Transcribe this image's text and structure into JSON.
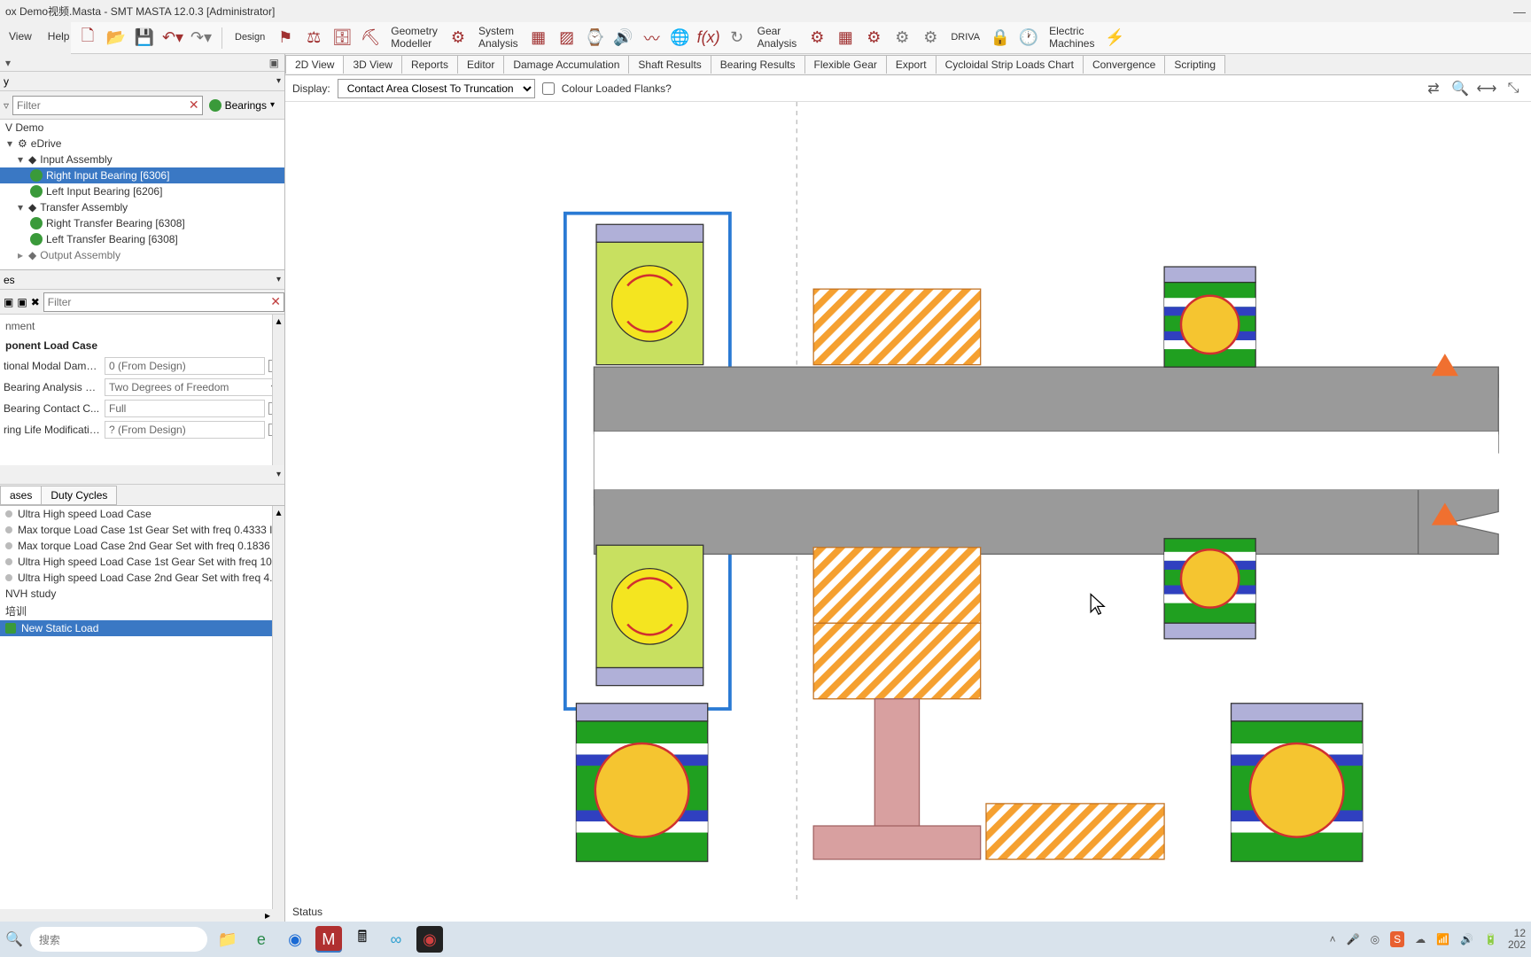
{
  "window": {
    "title": "ox Demo视频.Masta - SMT MASTA 12.0.3 [Administrator]"
  },
  "menu": {
    "view": "View",
    "help": "Help"
  },
  "toolbar": {
    "design": "Design",
    "geometry1": "Geometry",
    "geometry2": "Modeller",
    "system1": "System",
    "system2": "Analysis",
    "gear1": "Gear",
    "gear2": "Analysis",
    "driva": "DRIVA",
    "electric1": "Electric",
    "electric2": "Machines"
  },
  "subtabs": [
    "2D View",
    "3D View",
    "Reports",
    "Editor",
    "Damage Accumulation",
    "Shaft Results",
    "Bearing Results",
    "Flexible Gear",
    "Export",
    "Cycloidal Strip Loads Chart",
    "Convergence",
    "Scripting"
  ],
  "display": {
    "label": "Display:",
    "value": "Contact Area Closest To Truncation",
    "colour_flanks": "Colour Loaded Flanks?"
  },
  "left": {
    "dropdown1": "y",
    "filter_ph": "Filter",
    "bearings_btn": "Bearings",
    "tree": {
      "root": "V Demo",
      "edrive": "eDrive",
      "input_asm": "Input Assembly",
      "right_input": "Right Input Bearing [6306]",
      "left_input": "Left Input Bearing [6206]",
      "transfer_asm": "Transfer Assembly",
      "right_transfer": "Right Transfer Bearing [6308]",
      "left_transfer": "Left Transfer Bearing [6308]",
      "output_asm": "Output Assembly"
    },
    "props_drop": "es",
    "filter2_ph": "Filter",
    "props": {
      "comment": "nment",
      "section": "ponent Load Case",
      "modal_damp_lbl": "tional Modal Damp...",
      "modal_damp_val": "0 (From Design)",
      "analysis_lbl": "Bearing Analysis M...",
      "analysis_val": "Two Degrees of Freedom",
      "contact_lbl": "Bearing Contact C...",
      "contact_val": "Full",
      "life_lbl": "ring Life Modificatio...",
      "life_val": "? (From Design)"
    },
    "load_tabs": {
      "cases": "ases",
      "duty": "Duty Cycles"
    },
    "loads": [
      "Ultra High speed Load Case",
      "Max torque Load Case 1st Gear Set with freq 0.4333 I",
      "Max torque Load Case 2nd Gear Set with freq 0.1836",
      "Ultra High speed Load Case 1st Gear Set with freq 10",
      "Ultra High speed Load Case 2nd Gear Set with freq 4.",
      "NVH study",
      "培训",
      "New Static Load"
    ]
  },
  "status": "Status",
  "taskbar": {
    "search_ph": "搜索",
    "time": "12",
    "date": "202"
  }
}
